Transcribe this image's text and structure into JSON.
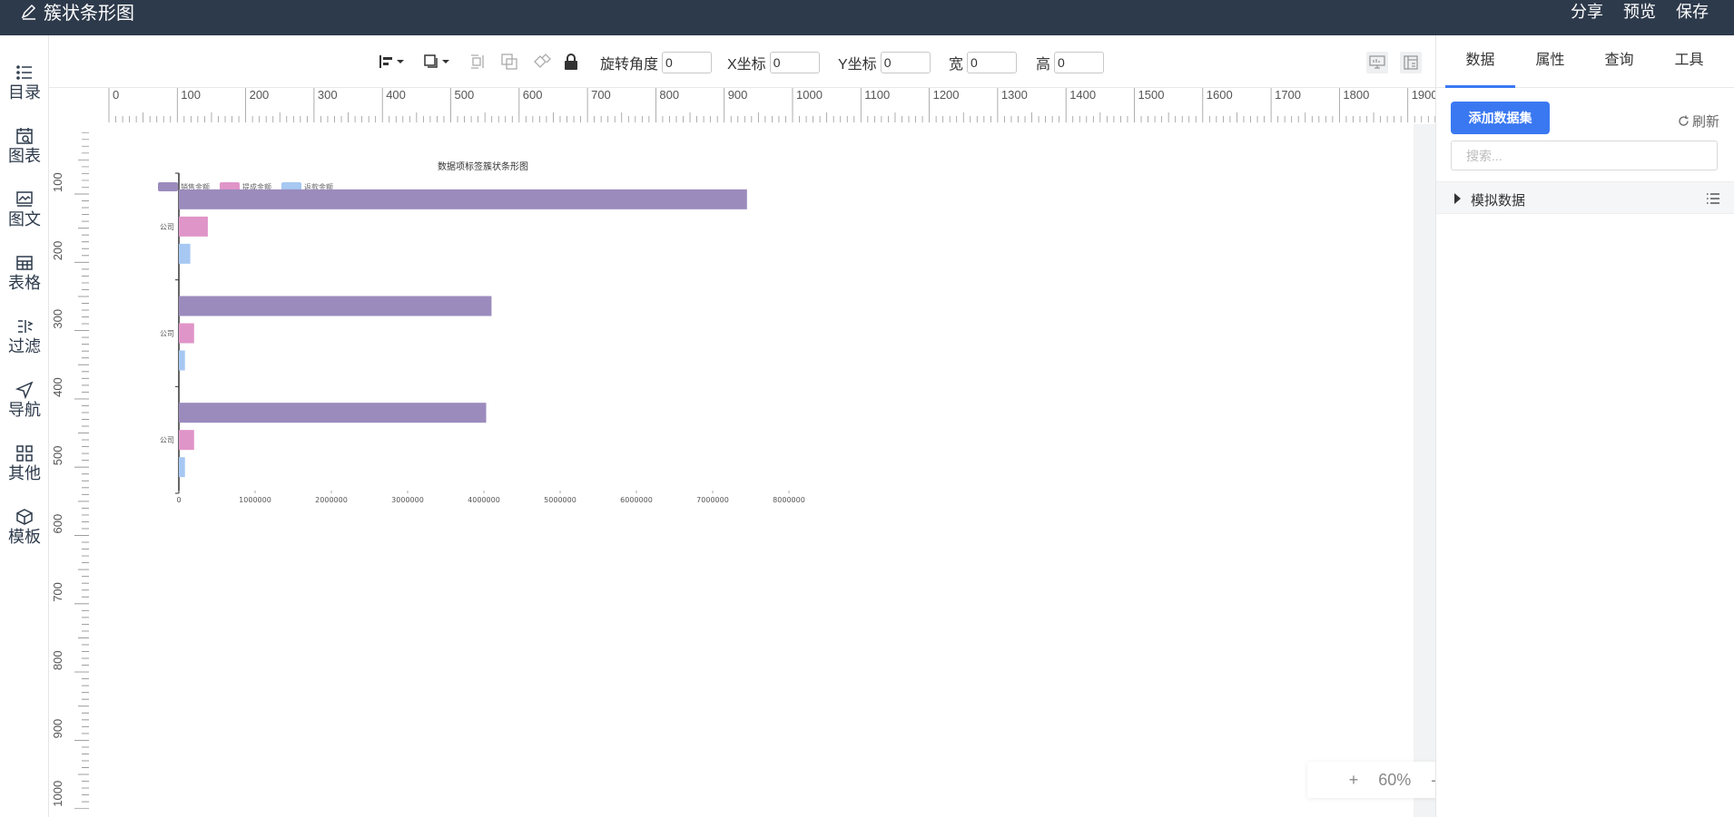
{
  "app": {
    "title": "簇状条形图",
    "title_icon": "edit-pen-icon"
  },
  "header": {
    "actions": [
      "分享",
      "预览",
      "保存"
    ]
  },
  "leftnav": {
    "items": [
      {
        "label": "目录",
        "icon": "list-icon"
      },
      {
        "label": "图表",
        "icon": "calendar-chart-icon"
      },
      {
        "label": "图文",
        "icon": "image-text-icon"
      },
      {
        "label": "表格",
        "icon": "table-icon"
      },
      {
        "label": "过滤",
        "icon": "filter-icon"
      },
      {
        "label": "导航",
        "icon": "navigation-icon"
      },
      {
        "label": "其他",
        "icon": "grid-icon"
      },
      {
        "label": "模板",
        "icon": "template-icon"
      }
    ]
  },
  "toolbar": {
    "rotation": {
      "label": "旋转角度",
      "value": "0"
    },
    "x": {
      "label": "X坐标",
      "value": "0"
    },
    "y": {
      "label": "Y坐标",
      "value": "0"
    },
    "width": {
      "label": "宽",
      "value": "0"
    },
    "height": {
      "label": "高",
      "value": "0"
    }
  },
  "rulers": {
    "top_labels": [
      "0",
      "100",
      "200",
      "300",
      "400",
      "500",
      "600",
      "700",
      "800",
      "900",
      "1000",
      "1100",
      "1200",
      "1300",
      "1400",
      "1500",
      "1600",
      "1700",
      "1800",
      "1900"
    ],
    "left_labels": [
      "100",
      "200",
      "300",
      "400",
      "500",
      "600",
      "700",
      "800",
      "900",
      "1000"
    ]
  },
  "zoom": {
    "plus": "+",
    "level": "60%",
    "minus": "-"
  },
  "rightpanel": {
    "tabs": [
      "数据",
      "属性",
      "查询",
      "工具"
    ],
    "active_tab": 0,
    "add_dataset_label": "添加数据集",
    "refresh_label": "刷新",
    "search_placeholder": "搜索...",
    "dataset_name": "模拟数据"
  },
  "colors": {
    "topbar": "#2d3a4b",
    "accent": "#3a78f2"
  },
  "chart_data": {
    "type": "bar",
    "orientation": "horizontal",
    "title": "数据项标签簇状条形图",
    "categories": [
      "公司",
      "公司",
      "公司"
    ],
    "series": [
      {
        "name": "销售金额",
        "color": "#9b8bbd",
        "values": [
          7450000,
          4100000,
          4030000
        ]
      },
      {
        "name": "提成金额",
        "color": "#e095c8",
        "values": [
          380000,
          200000,
          200000
        ]
      },
      {
        "name": "返款金额",
        "color": "#a6c8f2",
        "values": [
          150000,
          80000,
          80000
        ]
      }
    ],
    "xlim": [
      0,
      8000000
    ],
    "xticks": [
      "0",
      "1000000",
      "2000000",
      "3000000",
      "4000000",
      "5000000",
      "6000000",
      "7000000",
      "8000000"
    ],
    "legend": "top-left",
    "grid": false
  }
}
